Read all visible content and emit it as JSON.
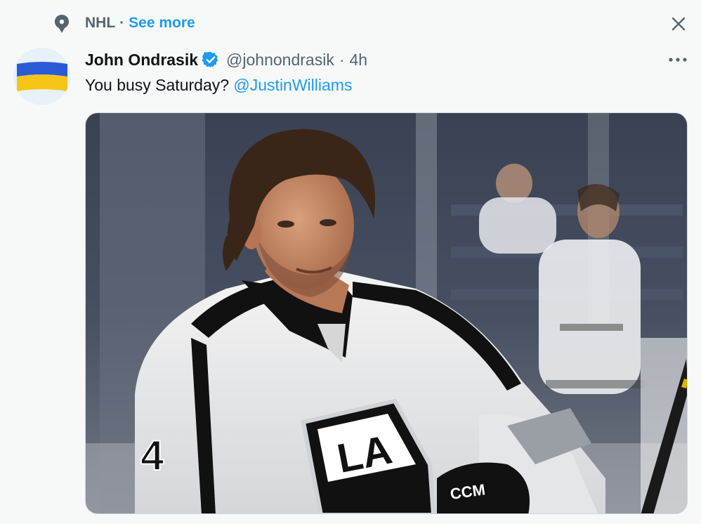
{
  "context": {
    "topic": "NHL",
    "separator": "·",
    "see_more": "See more",
    "icons": {
      "topic": "topic-pin-icon",
      "close": "close-icon"
    }
  },
  "tweet": {
    "display_name": "John Ondrasik",
    "verified_icon": "verified-badge-icon",
    "handle": "@johnondrasik",
    "separator": "·",
    "time": "4h",
    "more_icon": "more-dots-icon",
    "text": "You busy Saturday?",
    "mention": "@JustinWilliams",
    "avatar_icon": "ukraine-flag-avatar",
    "media": {
      "type": "photo",
      "jersey_logo": "LA",
      "jersey_number_fragment": "4",
      "glove_text": "CCM"
    }
  },
  "colors": {
    "background": "#f7f9f9",
    "accent": "#1d9bf0",
    "text_primary": "#0f1419",
    "text_secondary": "#536471",
    "flag_blue": "#2a5bd7",
    "flag_yellow": "#f5c518"
  }
}
